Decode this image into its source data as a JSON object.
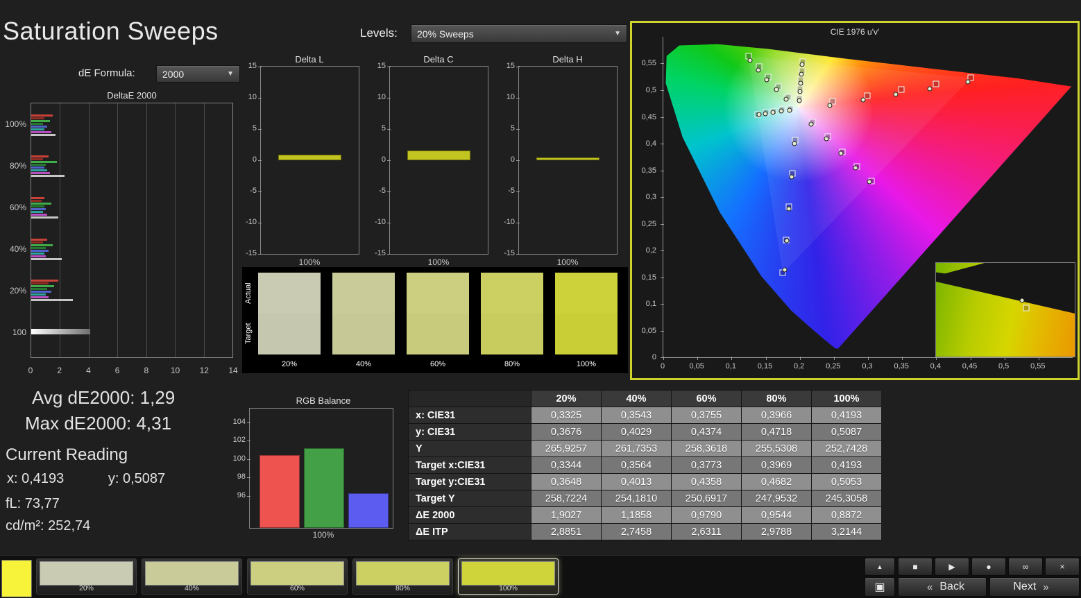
{
  "window": {
    "title": "Saturation Sweeps"
  },
  "controls": {
    "levels_label": "Levels:",
    "levels_value": "20% Sweeps",
    "de_formula_label": "dE Formula:",
    "de_formula_value": "2000"
  },
  "stats": {
    "avg": "Avg dE2000: 1,29",
    "max": "Max dE2000: 4,31",
    "current_reading_title": "Current Reading",
    "x": "x: 0,4193",
    "y": "y: 0,5087",
    "fl": "fL: 73,77",
    "cd": "cd/m²: 252,74"
  },
  "swatch_panel": {
    "actual_label": "Actual",
    "target_label": "Target",
    "items": [
      {
        "label": "20%",
        "color": "#c9ccb2",
        "target_color": "#c5c8ae"
      },
      {
        "label": "40%",
        "color": "#c9cc99",
        "target_color": "#c6c995"
      },
      {
        "label": "60%",
        "color": "#cbcf7f",
        "target_color": "#c7cb7b"
      },
      {
        "label": "80%",
        "color": "#cccf62",
        "target_color": "#c8cb5e"
      },
      {
        "label": "100%",
        "color": "#cdd23b",
        "target_color": "#c9ce37"
      }
    ]
  },
  "table": {
    "header": [
      "",
      "20%",
      "40%",
      "60%",
      "80%",
      "100%"
    ],
    "rows": [
      {
        "label": "x: CIE31",
        "values": [
          "0,3325",
          "0,3543",
          "0,3755",
          "0,3966",
          "0,4193"
        ]
      },
      {
        "label": "y: CIE31",
        "values": [
          "0,3676",
          "0,4029",
          "0,4374",
          "0,4718",
          "0,5087"
        ]
      },
      {
        "label": "Y",
        "values": [
          "265,9257",
          "261,7353",
          "258,3618",
          "255,5308",
          "252,7428"
        ]
      },
      {
        "label": "Target x:CIE31",
        "values": [
          "0,3344",
          "0,3564",
          "0,3773",
          "0,3969",
          "0,4193"
        ]
      },
      {
        "label": "Target y:CIE31",
        "values": [
          "0,3648",
          "0,4013",
          "0,4358",
          "0,4682",
          "0,5053"
        ]
      },
      {
        "label": "Target Y",
        "values": [
          "258,7224",
          "254,1810",
          "250,6917",
          "247,9532",
          "245,3058"
        ]
      },
      {
        "label": "ΔE 2000",
        "values": [
          "1,9027",
          "1,1858",
          "0,9790",
          "0,9544",
          "0,8872"
        ]
      },
      {
        "label": "ΔE ITP",
        "values": [
          "2,8851",
          "2,7458",
          "2,6311",
          "2,9788",
          "3,2144"
        ]
      }
    ]
  },
  "chart_data": [
    {
      "type": "bar",
      "orientation": "horizontal",
      "title": "DeltaE 2000",
      "xlim": [
        0,
        14
      ],
      "xticks": [
        0,
        2,
        4,
        6,
        8,
        10,
        12,
        14
      ],
      "bar_colors": [
        "#c94238",
        "#8e2b22",
        "#3fae4a",
        "#237a2f",
        "#5063c8",
        "#2fa3a0",
        "#b84fc0",
        "#c6c6c6"
      ],
      "rows": [
        {
          "label": "100%",
          "values": [
            1.5,
            0.9,
            1.3,
            0.8,
            1.1,
            0.9,
            1.4,
            1.7
          ]
        },
        {
          "label": "80%",
          "values": [
            1.2,
            0.8,
            1.8,
            1.0,
            0.9,
            1.1,
            1.3,
            2.3
          ]
        },
        {
          "label": "60%",
          "values": [
            0.9,
            0.7,
            1.4,
            0.9,
            1.0,
            0.8,
            1.1,
            1.9
          ]
        },
        {
          "label": "40%",
          "values": [
            1.1,
            0.8,
            1.5,
            1.0,
            1.2,
            0.9,
            1.0,
            2.1
          ]
        },
        {
          "label": "20%",
          "values": [
            1.9,
            1.2,
            1.6,
            1.1,
            1.4,
            1.0,
            1.2,
            2.9
          ]
        },
        {
          "label": "100",
          "values": [
            4.1
          ],
          "single": true
        }
      ]
    },
    {
      "type": "bar",
      "title": "Delta L",
      "category": "100%",
      "value": 0.9,
      "ylim": [
        -15,
        15
      ],
      "yticks": [
        15,
        10,
        5,
        0,
        -5,
        -10,
        -15
      ],
      "bar_color": "#c2c41f"
    },
    {
      "type": "bar",
      "title": "Delta C",
      "category": "100%",
      "value": 1.6,
      "ylim": [
        -15,
        15
      ],
      "yticks": [
        15,
        10,
        5,
        0,
        -5,
        -10,
        -15
      ],
      "bar_color": "#c2c41f"
    },
    {
      "type": "bar",
      "title": "Delta H",
      "category": "100%",
      "value": 0.4,
      "ylim": [
        -15,
        15
      ],
      "yticks": [
        15,
        10,
        5,
        0,
        -5,
        -10,
        -15
      ],
      "bar_color": "#c2c41f"
    },
    {
      "type": "bar",
      "title": "RGB Balance",
      "category": "100%",
      "ylim": [
        92.5,
        105.5
      ],
      "yticks": [
        104,
        102,
        100,
        98,
        96
      ],
      "series": [
        {
          "name": "red",
          "color": "#ef5350",
          "value": 100.4
        },
        {
          "name": "green",
          "color": "#43a047",
          "value": 101.2
        },
        {
          "name": "blue",
          "color": "#5c5cf0",
          "value": 96.3
        }
      ]
    },
    {
      "type": "scatter",
      "title": "CIE 1976 u'v'",
      "xlim": [
        0,
        0.6
      ],
      "ylim": [
        0,
        0.6
      ],
      "xticks": [
        "0",
        "0,05",
        "0,1",
        "0,15",
        "0,2",
        "0,25",
        "0,3",
        "0,35",
        "0,4",
        "0,45",
        "0,5",
        "0,55"
      ],
      "yticks": [
        "0",
        "0,05",
        "0,1",
        "0,15",
        "0,2",
        "0,25",
        "0,3",
        "0,35",
        "0,4",
        "0,45",
        "0,5",
        "0,55"
      ],
      "targets": [
        [
          0.248,
          0.479
        ],
        [
          0.299,
          0.49
        ],
        [
          0.349,
          0.501
        ],
        [
          0.4,
          0.512
        ],
        [
          0.451,
          0.523
        ],
        [
          0.183,
          0.487
        ],
        [
          0.169,
          0.506
        ],
        [
          0.154,
          0.525
        ],
        [
          0.14,
          0.544
        ],
        [
          0.125,
          0.563
        ],
        [
          0.193,
          0.406
        ],
        [
          0.189,
          0.344
        ],
        [
          0.184,
          0.282
        ],
        [
          0.18,
          0.22
        ],
        [
          0.175,
          0.158
        ],
        [
          0.186,
          0.465
        ],
        [
          0.174,
          0.463
        ],
        [
          0.162,
          0.46
        ],
        [
          0.15,
          0.458
        ],
        [
          0.138,
          0.455
        ],
        [
          0.219,
          0.44
        ],
        [
          0.241,
          0.413
        ],
        [
          0.262,
          0.385
        ],
        [
          0.284,
          0.357
        ],
        [
          0.305,
          0.33
        ],
        [
          0.199,
          0.485
        ],
        [
          0.2,
          0.502
        ],
        [
          0.201,
          0.519
        ],
        [
          0.203,
          0.536
        ],
        [
          0.204,
          0.553
        ]
      ],
      "measurements": [
        [
          0.244,
          0.472
        ],
        [
          0.293,
          0.482
        ],
        [
          0.341,
          0.492
        ],
        [
          0.391,
          0.503
        ],
        [
          0.446,
          0.516
        ],
        [
          0.18,
          0.483
        ],
        [
          0.166,
          0.501
        ],
        [
          0.152,
          0.519
        ],
        [
          0.139,
          0.538
        ],
        [
          0.127,
          0.556
        ],
        [
          0.192,
          0.4
        ],
        [
          0.188,
          0.338
        ],
        [
          0.184,
          0.278
        ],
        [
          0.181,
          0.218
        ],
        [
          0.178,
          0.163
        ],
        [
          0.185,
          0.462
        ],
        [
          0.173,
          0.461
        ],
        [
          0.161,
          0.459
        ],
        [
          0.149,
          0.456
        ],
        [
          0.14,
          0.454
        ],
        [
          0.217,
          0.436
        ],
        [
          0.239,
          0.409
        ],
        [
          0.26,
          0.382
        ],
        [
          0.282,
          0.354
        ],
        [
          0.302,
          0.328
        ],
        [
          0.199,
          0.481
        ],
        [
          0.2,
          0.497
        ],
        [
          0.201,
          0.513
        ],
        [
          0.202,
          0.53
        ],
        [
          0.203,
          0.548
        ]
      ]
    }
  ],
  "bottom_bar": {
    "current_patch_color": "#f6f33a",
    "patches": [
      {
        "label": "20%",
        "color": "#c9ccb2",
        "selected": false
      },
      {
        "label": "40%",
        "color": "#c9cc99",
        "selected": false
      },
      {
        "label": "60%",
        "color": "#cbcf7f",
        "selected": false
      },
      {
        "label": "80%",
        "color": "#cccf62",
        "selected": false
      },
      {
        "label": "100%",
        "color": "#ced43a",
        "selected": true
      }
    ],
    "up_button": {
      "icon": "up-arrow",
      "glyph": "▲"
    },
    "patch_window_button": {
      "icon": "square-in-square",
      "glyph": "▣"
    },
    "transport_buttons": [
      {
        "name": "stop",
        "glyph": "■"
      },
      {
        "name": "play",
        "glyph": "▶"
      },
      {
        "name": "record",
        "glyph": "●"
      },
      {
        "name": "loop",
        "glyph": "∞"
      },
      {
        "name": "close",
        "glyph": "×"
      }
    ],
    "back_button": {
      "chevron": "«",
      "label": "Back"
    },
    "next_button": {
      "label": "Next",
      "chevron": "»"
    }
  }
}
